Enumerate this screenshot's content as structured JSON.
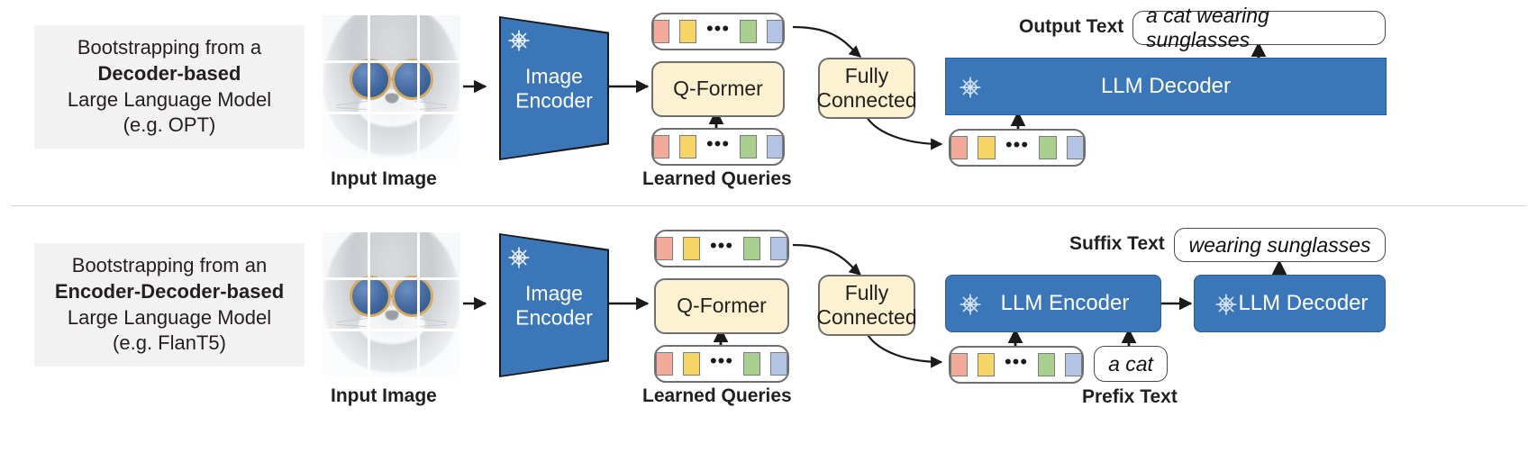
{
  "figure": {
    "title": "BLIP-2 bootstrapping architectures",
    "divider": true,
    "colors": {
      "llm_blue": "#3a76b8",
      "qformer_cream": "#fcf2d1",
      "panel_gray": "#f2f2f2",
      "token_salmon": "#f2ab9b",
      "token_yellow": "#f7d667",
      "token_green": "#a8cf8e",
      "token_blue": "#b3c3e4",
      "text_dark": "#231f20"
    }
  },
  "rows": [
    {
      "id": "decoder-row",
      "caption": {
        "line1": "Bootstrapping from a",
        "line2_bold": "Decoder-based",
        "line3": "Large Language Model",
        "line4": "(e.g. OPT)"
      },
      "image_label": "Input Image",
      "encoder_label_line1": "Image",
      "encoder_label_line2": "Encoder",
      "encoder_icon": "snowflake-icon",
      "qformer_label": "Q-Former",
      "queries_label": "Learned Queries",
      "fc_label_line1": "Fully",
      "fc_label_line2": "Connected",
      "llm_blocks": [
        {
          "label": "LLM Decoder",
          "icon": "snowflake-icon"
        }
      ],
      "output_label": "Output Text",
      "output_text": "a cat wearing sunglasses",
      "tokens": [
        "salmon",
        "yellow",
        "ellipsis",
        "green",
        "blue"
      ]
    },
    {
      "id": "encoder-decoder-row",
      "caption": {
        "line1": "Bootstrapping from an",
        "line2_bold": "Encoder-Decoder-based",
        "line3": "Large Language Model",
        "line4": "(e.g. FlanT5)"
      },
      "image_label": "Input Image",
      "encoder_label_line1": "Image",
      "encoder_label_line2": "Encoder",
      "encoder_icon": "snowflake-icon",
      "qformer_label": "Q-Former",
      "queries_label": "Learned Queries",
      "fc_label_line1": "Fully",
      "fc_label_line2": "Connected",
      "llm_blocks": [
        {
          "label": "LLM Encoder",
          "icon": "snowflake-icon"
        },
        {
          "label": "LLM Decoder",
          "icon": "snowflake-icon"
        }
      ],
      "output_label": "Suffix Text",
      "output_text": "wearing sunglasses",
      "prefix_label": "Prefix Text",
      "prefix_text": "a cat",
      "tokens": [
        "salmon",
        "yellow",
        "ellipsis",
        "green",
        "blue"
      ]
    }
  ]
}
